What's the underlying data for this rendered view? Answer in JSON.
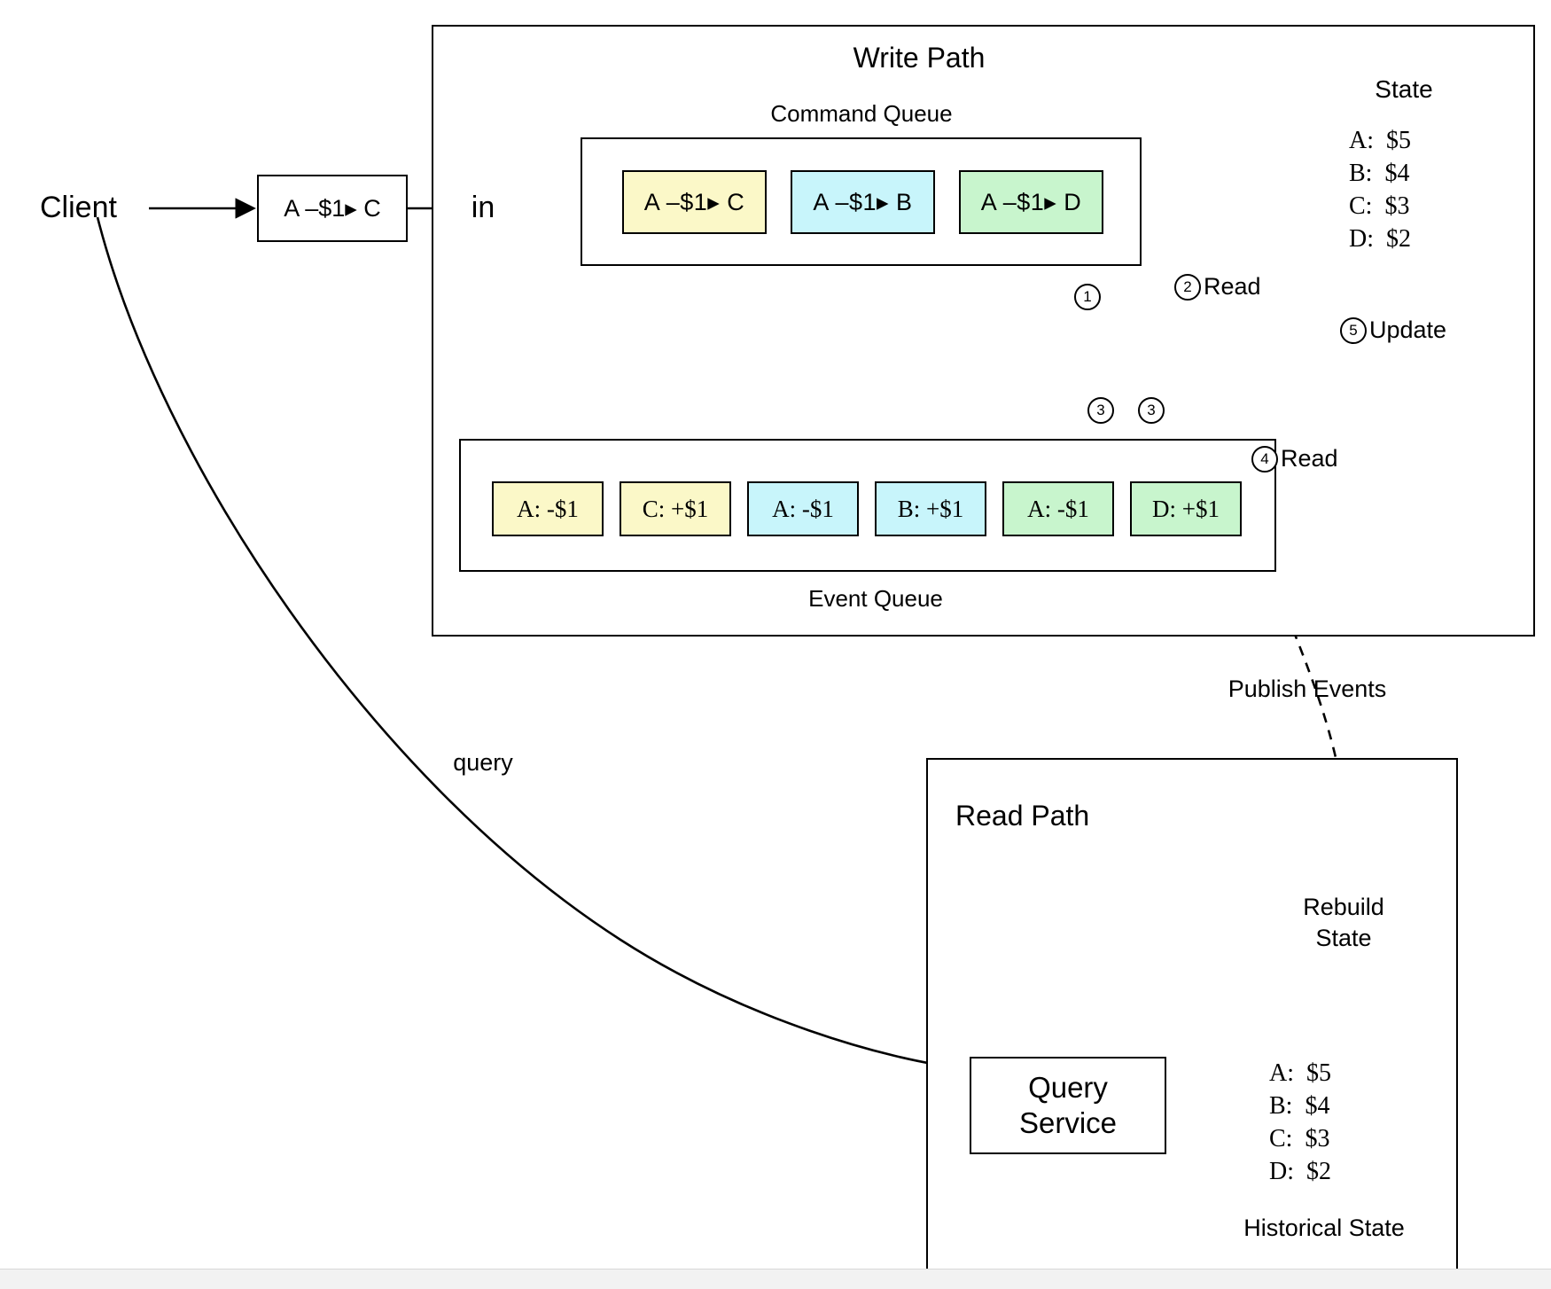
{
  "diagram": {
    "title_write": "Write Path",
    "title_read": "Read Path",
    "client_label": "Client",
    "client_command": "A –$1▸ C",
    "in_label": "in",
    "query_label": "query",
    "publish_label": "Publish Events",
    "rebuild_label_line1": "Rebuild",
    "rebuild_label_line2": "State",
    "command_queue_label": "Command Queue",
    "event_queue_label": "Event Queue",
    "query_service_line1": "Query",
    "query_service_line2": "Service",
    "historical_state_label": "Historical State"
  },
  "command_queue": {
    "label": "Command Queue",
    "items": [
      {
        "text": "A –$1▸ C",
        "color": "#fbf8c8"
      },
      {
        "text": "A –$1▸ B",
        "color": "#c8f5fb"
      },
      {
        "text": "A –$1▸ D",
        "color": "#c8f5cd"
      }
    ]
  },
  "event_queue": {
    "label": "Event Queue",
    "items": [
      {
        "text": "A: -$1",
        "color": "#fbf8c8"
      },
      {
        "text": "C: +$1",
        "color": "#fbf8c8"
      },
      {
        "text": "A: -$1",
        "color": "#c8f5fb"
      },
      {
        "text": "B: +$1",
        "color": "#c8f5fb"
      },
      {
        "text": "A: -$1",
        "color": "#c8f5cd"
      },
      {
        "text": "D: +$1",
        "color": "#c8f5cd"
      }
    ]
  },
  "state_store": {
    "title": "State",
    "rows": [
      "A:  $5",
      "B:  $4",
      "C:  $3",
      "D:  $2"
    ]
  },
  "historical_store": {
    "title": "Historical State",
    "rows": [
      "A:  $5",
      "B:  $4",
      "C:  $3",
      "D:  $2"
    ]
  },
  "steps": [
    {
      "num": "1",
      "text": ""
    },
    {
      "num": "2",
      "text": "Read"
    },
    {
      "num": "3",
      "text": ""
    },
    {
      "num": "3",
      "text": ""
    },
    {
      "num": "4",
      "text": "Read"
    },
    {
      "num": "5",
      "text": "Update"
    }
  ],
  "step_numbers": {
    "one": "1",
    "three_a": "3",
    "three_b": "3"
  },
  "step_labels": {
    "two_num": "2",
    "two_text": "Read",
    "four_num": "4",
    "four_text": "Read",
    "five_num": "5",
    "five_text": "Update"
  },
  "colors": {
    "yellow": "#fbf8c8",
    "cyan": "#c8f5fb",
    "green": "#c8f5cd",
    "stroke": "#000000",
    "background": "#ffffff"
  }
}
